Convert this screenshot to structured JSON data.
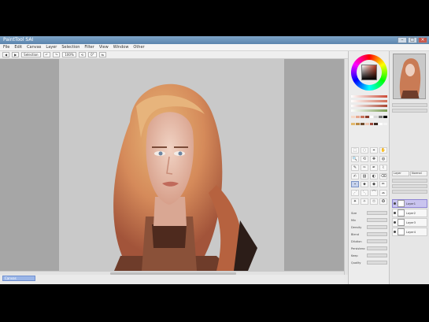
{
  "window": {
    "title": "PaintTool SAI",
    "btn_min": "–",
    "btn_max": "□",
    "btn_close": "×"
  },
  "menus": [
    "File",
    "Edit",
    "Canvas",
    "Layer",
    "Selection",
    "Filter",
    "View",
    "Window",
    "Other"
  ],
  "toolbar": [
    "◀",
    "▶",
    "Selection",
    "↶",
    "↷",
    "100%",
    "⟲",
    "0°",
    "⇆"
  ],
  "status": {
    "canvas_tab": "Canvas"
  },
  "color_panel": {
    "sliders": [
      "#cc4b37",
      "#d26f58",
      "#a8432f",
      "#7a9c52"
    ],
    "swatches": [
      "#f6d7c4",
      "#e7a78d",
      "#c9725a",
      "#8a3c2a",
      "#ffffff",
      "#d9d9d9",
      "#777777",
      "#000000",
      "#e2b96d",
      "#bb8a45",
      "#6e4a2c",
      "#f0c6b2",
      "#a04b3c",
      "#3b2a21",
      "#ffffff",
      "#f5f5f5"
    ]
  },
  "tools": [
    "⬚",
    "◌",
    "⌖",
    "✋",
    "🔍",
    "⟲",
    "✚",
    "◍",
    "✎",
    "✑",
    "✒",
    "⌇",
    "✍",
    "▨",
    "◐",
    "⌫",
    "⬩",
    "⬥",
    "◆",
    "✏",
    "⋰",
    "⋱",
    "⌒",
    "⌓",
    "✦",
    "✧",
    "✩",
    "✪"
  ],
  "brush_props": [
    "Size",
    "Min",
    "Density",
    "Blend",
    "Dilution",
    "Persistence",
    "Keep",
    "Quality"
  ],
  "layer_panel": {
    "tabs": [
      "Layer",
      "Normal"
    ],
    "rows": [
      "",
      "",
      "",
      "",
      ""
    ],
    "layers": [
      {
        "name": "Layer1",
        "selected": true
      },
      {
        "name": "Layer2",
        "selected": false
      },
      {
        "name": "Layer3",
        "selected": false
      },
      {
        "name": "Layer4",
        "selected": false
      }
    ]
  }
}
